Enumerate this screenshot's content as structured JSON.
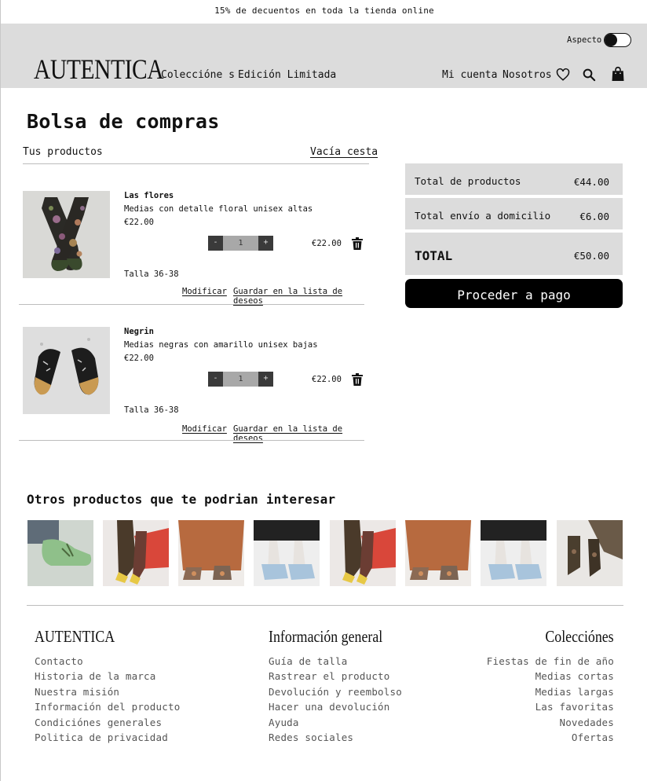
{
  "promo": "15% de decuentos en toda la tienda online",
  "header": {
    "aspect_label": "Aspecto",
    "logo": "AUTENTICA",
    "nav_left": [
      "Coleccióne s",
      "Edición Limitada"
    ],
    "nav_right": [
      "Mi cuenta",
      "Nosotros"
    ],
    "icons": [
      "heart-icon",
      "search-icon",
      "shopping-bag-icon"
    ]
  },
  "cart": {
    "title": "Bolsa de compras",
    "subtitle": "Tus productos",
    "empty_label": "Vacía cesta",
    "items": [
      {
        "name": "Las flores",
        "description": "Medias con detalle floral unisex altas",
        "price": "€22.00",
        "qty": "1",
        "minus": "-",
        "plus": "+",
        "line_total": "€22.00",
        "size": "Talla 36-38",
        "modify": "Modificar",
        "wishlist": "Guardar en la lista de deseos"
      },
      {
        "name": "Negrin",
        "description": "Medias negras con amarillo unisex bajas",
        "price": "€22.00",
        "qty": "1",
        "minus": "-",
        "plus": "+",
        "line_total": "€22.00",
        "size": "Talla 36-38",
        "modify": "Modificar",
        "wishlist": "Guardar en la lista de deseos"
      }
    ]
  },
  "summary": {
    "products_label": "Total de productos",
    "products_value": "€44.00",
    "shipping_label": "Total envío a domicilio",
    "shipping_value": "€6.00",
    "total_label": "TOTAL",
    "total_value": "€50.00",
    "checkout": "Proceder a pago"
  },
  "recommendations": {
    "title": "Otros productos que te podrian interesar"
  },
  "footer": {
    "brand": {
      "title": "AUTENTICA",
      "links": [
        "Contacto",
        "Historia de la marca",
        "Nuestra misión",
        "Información del producto",
        "Condiciónes generales",
        "Politica de privacidad"
      ]
    },
    "info": {
      "title": "Información general",
      "links": [
        "Guía de talla",
        "Rastrear el producto",
        "Devolución y reembolso",
        "Hacer una devolución",
        "Ayuda",
        "Redes sociales"
      ]
    },
    "collections": {
      "title": "Colecciónes",
      "links": [
        "Fiestas de fin de año",
        "Medias cortas",
        "Medias largas",
        "Las favoritas",
        "Novedades",
        "Ofertas"
      ]
    }
  },
  "colors": {
    "header_bg": "#dcdcdc",
    "button_bg": "#000000",
    "stepper_dark": "#3a3a3a",
    "stepper_light": "#a8a8a8"
  }
}
